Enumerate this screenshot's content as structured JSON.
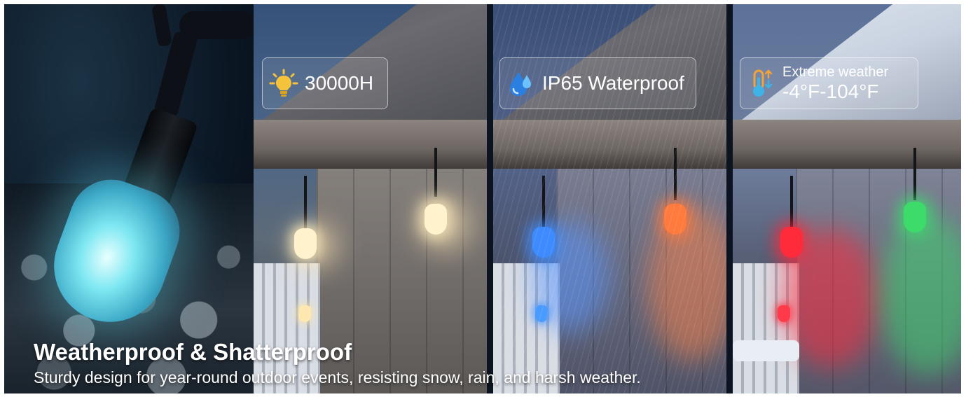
{
  "features": [
    {
      "icon": "lightbulb-icon",
      "text": "30000H"
    },
    {
      "icon": "water-drop-icon",
      "text": "IP65 Waterproof"
    },
    {
      "icon": "thermometer-icon",
      "line1": "Extreme weather",
      "line2": "-4°F-104°F"
    }
  ],
  "caption": {
    "headline": "Weatherproof & Shatterproof",
    "subline": "Sturdy design for year-round outdoor events, resisting snow, rain, and harsh weather."
  },
  "colors": {
    "hero_bulb": "#7fe8f2",
    "warm_white": "#fff2cc",
    "blue": "#3d8bff",
    "orange": "#ff7a3d",
    "red": "#ff2a3a",
    "green": "#3ddc6a"
  }
}
